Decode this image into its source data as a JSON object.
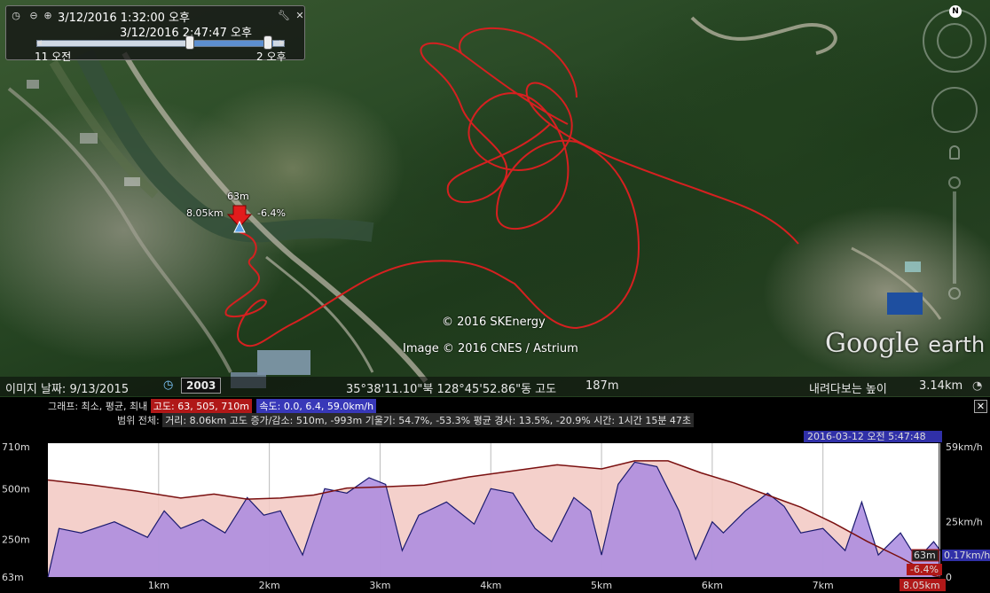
{
  "time_slider": {
    "start_datetime": "3/12/2016   1:32:00 오후",
    "end_datetime": "3/12/2016   2:47:47 오후",
    "left_label": "11 오전",
    "right_label": "2 오후"
  },
  "map_labels": {
    "marker_altitude": "63m",
    "marker_distance": "8.05km",
    "marker_grade": "-6.4%"
  },
  "copyright": {
    "sk": "© 2016 SKEnergy",
    "cnes": "Image © 2016 CNES / Astrium"
  },
  "logo": {
    "google": "Google",
    "earth": "earth"
  },
  "status_bar": {
    "imagery_date": "이미지 날짜: 9/13/2015",
    "historical_year": "2003",
    "coordinates": "35°38'11.10\"북 128°45'52.86\"동 고도",
    "elevation": "187m",
    "eye_alt_label": "내려다보는 높이",
    "eye_alt": "3.14km"
  },
  "profile": {
    "graph_label": "그래프: 최소, 평균, 최내",
    "altitude_stats": "고도: 63, 505, 710m",
    "speed_stats": "속도: 0.0, 6.4, 59.0km/h",
    "range_label": "범위 전체:",
    "range_stats": "거리: 8.06km 고도 증가/감소: 510m, -993m 기울기: 54.7%, -53.3% 평균 경사: 13.5%, -20.9% 시간: 1시간 15분 47초",
    "cursor_datetime": "2016-03-12 오전 5:47:48",
    "cursor_altitude": "63m",
    "cursor_speed": "0.17km/h",
    "cursor_grade": "-6.4%",
    "cursor_distance": "8.05km"
  },
  "chart_data": {
    "type": "area",
    "x_tick_labels": [
      "1km",
      "2km",
      "3km",
      "4km",
      "5km",
      "6km",
      "7km"
    ],
    "y_left_tick_labels": [
      "710m",
      "500m",
      "250m",
      "63m"
    ],
    "y_right_tick_labels": [
      "59km/h",
      "25km/h",
      "0"
    ],
    "xlim": [
      0,
      8.06
    ],
    "ylim_left": [
      63,
      710
    ],
    "ylim_right": [
      0,
      59
    ],
    "series": [
      {
        "name": "고도",
        "color": "#7a1010",
        "fill": "#f3cbc5",
        "x": [
          0,
          0.4,
          0.8,
          1.2,
          1.5,
          1.8,
          2.1,
          2.4,
          2.7,
          3.0,
          3.4,
          3.8,
          4.2,
          4.6,
          5.0,
          5.3,
          5.6,
          5.9,
          6.2,
          6.5,
          6.8,
          7.1,
          7.4,
          7.7,
          8.0,
          8.06
        ],
        "values": [
          545,
          520,
          490,
          455,
          475,
          450,
          455,
          470,
          505,
          510,
          520,
          560,
          590,
          620,
          600,
          640,
          640,
          580,
          530,
          470,
          410,
          330,
          240,
          160,
          70,
          63
        ]
      },
      {
        "name": "속도",
        "color": "#1a1a6e",
        "fill": "#a989e0",
        "x": [
          0,
          0.1,
          0.3,
          0.6,
          0.9,
          1.05,
          1.2,
          1.4,
          1.6,
          1.8,
          1.95,
          2.1,
          2.3,
          2.5,
          2.7,
          2.9,
          3.05,
          3.2,
          3.35,
          3.6,
          3.85,
          4.0,
          4.2,
          4.4,
          4.55,
          4.75,
          4.9,
          5.0,
          5.15,
          5.3,
          5.5,
          5.7,
          5.85,
          6.0,
          6.1,
          6.3,
          6.5,
          6.65,
          6.8,
          7.0,
          7.2,
          7.35,
          7.5,
          7.7,
          7.85,
          8.0,
          8.06
        ],
        "values": [
          0,
          22,
          20,
          25,
          18,
          30,
          22,
          26,
          20,
          36,
          28,
          30,
          10,
          40,
          38,
          45,
          42,
          12,
          28,
          34,
          24,
          40,
          38,
          22,
          16,
          36,
          30,
          10,
          42,
          52,
          50,
          30,
          8,
          25,
          20,
          30,
          38,
          32,
          20,
          22,
          12,
          34,
          10,
          20,
          8,
          16,
          12
        ]
      }
    ],
    "grid": true
  }
}
